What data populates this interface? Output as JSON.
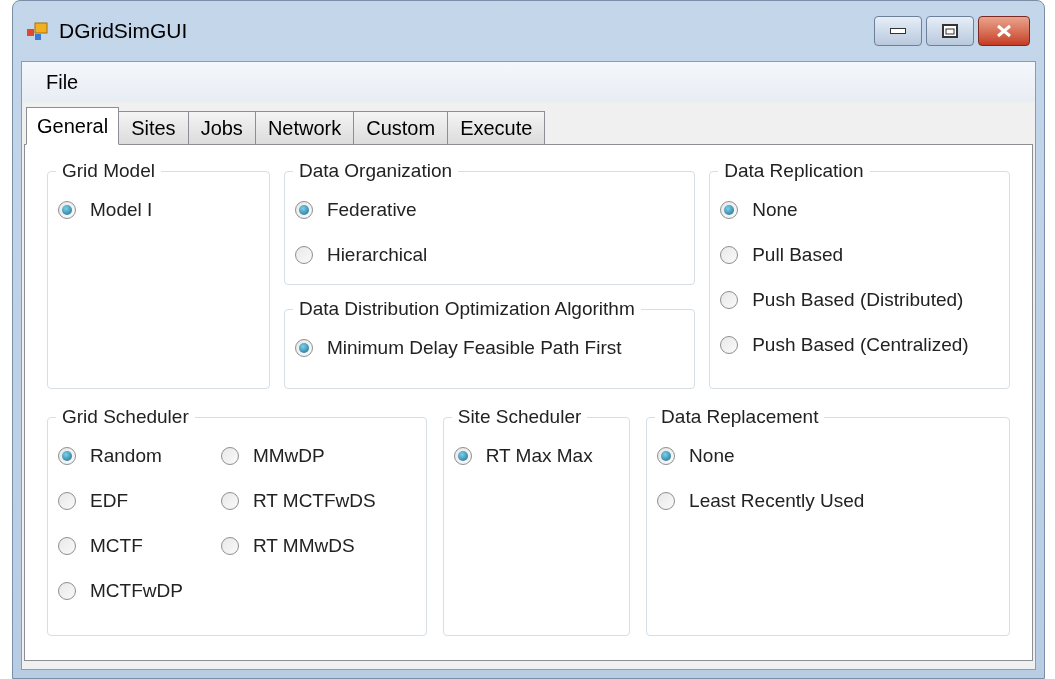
{
  "window": {
    "title": "DGridSimGUI"
  },
  "menu": [
    "File"
  ],
  "tabs": [
    {
      "label": "General",
      "selected": true
    },
    {
      "label": "Sites",
      "selected": false
    },
    {
      "label": "Jobs",
      "selected": false
    },
    {
      "label": "Network",
      "selected": false
    },
    {
      "label": "Custom",
      "selected": false
    },
    {
      "label": "Execute",
      "selected": false
    }
  ],
  "groups": [
    {
      "title": "Grid Model",
      "options": [
        {
          "label": "Model I",
          "selected": true
        }
      ]
    },
    {
      "title": "Data Organization",
      "options": [
        {
          "label": "Federative",
          "selected": true
        },
        {
          "label": "Hierarchical",
          "selected": false
        }
      ]
    },
    {
      "title": "Data Distribution Optimization Algorithm",
      "options": [
        {
          "label": "Minimum Delay Feasible Path First",
          "selected": true
        }
      ]
    },
    {
      "title": "Data Replication",
      "options": [
        {
          "label": "None",
          "selected": true
        },
        {
          "label": "Pull Based",
          "selected": false
        },
        {
          "label": "Push Based (Distributed)",
          "selected": false
        },
        {
          "label": "Push Based (Centralized)",
          "selected": false
        }
      ]
    },
    {
      "title": "Grid Scheduler",
      "options": [
        {
          "label": "Random",
          "selected": true
        },
        {
          "label": "EDF",
          "selected": false
        },
        {
          "label": "MCTF",
          "selected": false
        },
        {
          "label": "MCTFwDP",
          "selected": false
        },
        {
          "label": "MMwDP",
          "selected": false
        },
        {
          "label": "RT MCTFwDS",
          "selected": false
        },
        {
          "label": "RT MMwDS",
          "selected": false
        }
      ]
    },
    {
      "title": "Site Scheduler",
      "options": [
        {
          "label": "RT Max Max",
          "selected": true
        }
      ]
    },
    {
      "title": "Data Replacement",
      "options": [
        {
          "label": "None",
          "selected": true
        },
        {
          "label": "Least Recently Used",
          "selected": false
        }
      ]
    }
  ]
}
